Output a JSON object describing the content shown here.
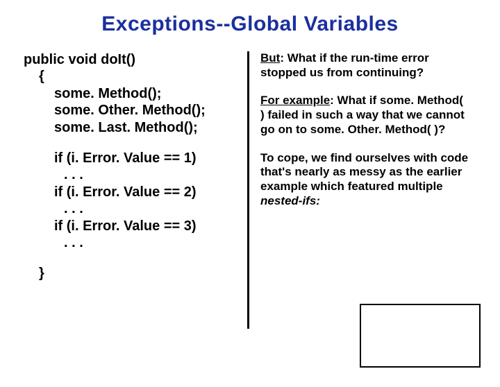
{
  "title": "Exceptions--Global Variables",
  "code": {
    "sig": "public void doIt()",
    "open": "{",
    "l1": "some. Method();",
    "l2": "some. Other. Method();",
    "l3": "some. Last. Method();",
    "if1": "if (i. Error. Value == 1)",
    "d1": ". . .",
    "if2": "if (i. Error. Value == 2)",
    "d2": ". . .",
    "if3": "if (i. Error. Value == 3)",
    "d3": ". . .",
    "close": "}"
  },
  "right": {
    "p1_lead": "But",
    "p1_rest": ": What if the run-time error stopped us from continuing?",
    "p2_lead": "For example",
    "p2_rest1": ": What if ",
    "p2_em1": "some. Method( )",
    "p2_rest2": " failed in such a way that we cannot go on to ",
    "p2_em2": "some. Other. Method( )",
    "p2_rest3": "?",
    "p3_a": "To cope, we find ourselves with code that's nearly as messy as the earlier  example which featured multiple ",
    "p3_em": "nested-ifs:",
    "p3_b": ""
  }
}
